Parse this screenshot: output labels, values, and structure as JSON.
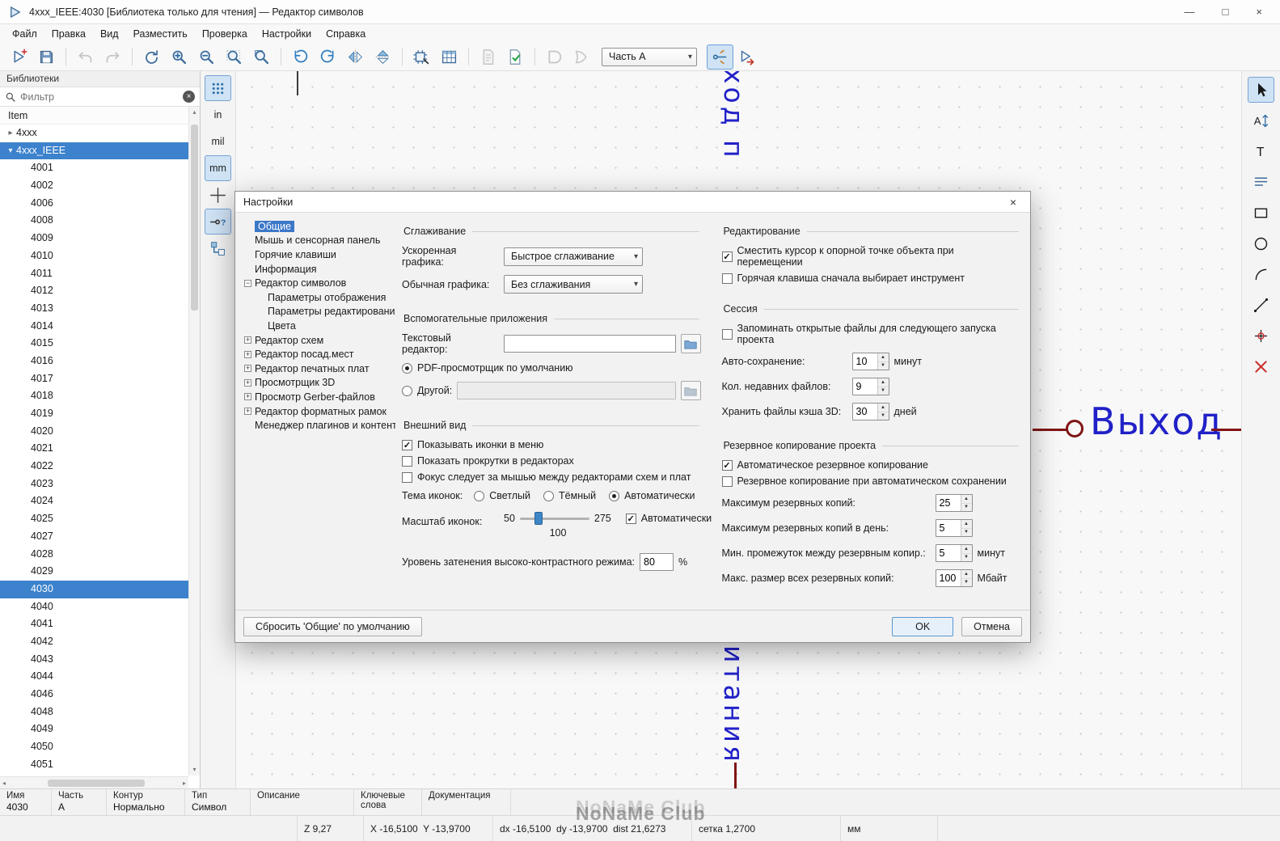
{
  "window": {
    "title": "4xxx_IEEE:4030 [Библиотека только для чтения] — Редактор символов",
    "minimize": "—",
    "maximize": "□",
    "close": "×"
  },
  "menubar": {
    "items": [
      "Файл",
      "Правка",
      "Вид",
      "Разместить",
      "Проверка",
      "Настройки",
      "Справка"
    ]
  },
  "toolbar": {
    "part_selector": "Часть A",
    "items": [
      {
        "id": "new-symbol"
      },
      {
        "id": "save"
      },
      {
        "sep": true
      },
      {
        "id": "undo",
        "disabled": true
      },
      {
        "id": "redo",
        "disabled": true
      },
      {
        "sep": true
      },
      {
        "id": "refresh-view"
      },
      {
        "id": "zoom-in"
      },
      {
        "id": "zoom-out"
      },
      {
        "id": "zoom-fit"
      },
      {
        "id": "zoom-selection"
      },
      {
        "sep": true
      },
      {
        "id": "rotate-left"
      },
      {
        "id": "rotate-right"
      },
      {
        "id": "mirror-h"
      },
      {
        "id": "mirror-v"
      },
      {
        "sep": true
      },
      {
        "id": "symbol-properties"
      },
      {
        "id": "pin-table"
      },
      {
        "sep": true
      },
      {
        "id": "datasheet",
        "disabled": true
      },
      {
        "id": "erc-check"
      },
      {
        "sep": true
      },
      {
        "id": "demorgan-standard",
        "disabled": true
      },
      {
        "id": "demorgan-alternate",
        "disabled": true
      },
      {
        "select": true
      },
      {
        "id": "sync-pins",
        "active": true
      },
      {
        "id": "add-to-schematic"
      }
    ]
  },
  "left_toolbar": {
    "items": [
      {
        "id": "grid-visibility",
        "active": true
      },
      {
        "id": "unit-inches",
        "label": "in"
      },
      {
        "id": "unit-mils",
        "label": "mil"
      },
      {
        "id": "unit-mm",
        "label": "mm",
        "active": true
      },
      {
        "id": "cursor-shape"
      },
      {
        "id": "pin-type",
        "active": true
      },
      {
        "id": "symbol-tree"
      }
    ]
  },
  "right_toolbar": {
    "items": [
      {
        "id": "select-tool",
        "active": true
      },
      {
        "id": "text-size-tool"
      },
      {
        "id": "text-tool"
      },
      {
        "id": "fields-table"
      },
      {
        "id": "rectangle-tool"
      },
      {
        "id": "circle-tool"
      },
      {
        "id": "arc-tool"
      },
      {
        "id": "line-tool"
      },
      {
        "id": "anchor-tool"
      },
      {
        "id": "delete-tool"
      }
    ]
  },
  "libraries": {
    "header": "Библиотеки",
    "filter_placeholder": "Фильтр",
    "root": "Item",
    "group": "4xxx",
    "library": "4xxx_IEEE",
    "selected": "4030",
    "items": [
      "4001",
      "4002",
      "4006",
      "4008",
      "4009",
      "4010",
      "4011",
      "4012",
      "4013",
      "4014",
      "4015",
      "4016",
      "4017",
      "4018",
      "4019",
      "4020",
      "4021",
      "4022",
      "4023",
      "4024",
      "4025",
      "4027",
      "4028",
      "4029",
      "4030",
      "4040",
      "4041",
      "4042",
      "4043",
      "4044",
      "4046",
      "4048",
      "4049",
      "4050",
      "4051"
    ]
  },
  "canvas": {
    "pin_label_vertical_top": "ход п",
    "pin_label_vertical_bottom": "итания",
    "pin_label_horizontal": "Выход",
    "label_color": "#2121c8",
    "pin_color": "#801515"
  },
  "dialog": {
    "title": "Настройки",
    "close": "×",
    "tree": [
      {
        "label": "Общие",
        "level": 0,
        "selected": true
      },
      {
        "label": "Мышь и сенсорная панель",
        "level": 0
      },
      {
        "label": "Горячие клавиши",
        "level": 0
      },
      {
        "label": "Информация",
        "level": 0
      },
      {
        "label": "Редактор символов",
        "level": 0,
        "expander": "minus"
      },
      {
        "label": "Параметры отображения",
        "level": 1
      },
      {
        "label": "Параметры редактирования",
        "level": 1
      },
      {
        "label": "Цвета",
        "level": 1
      },
      {
        "label": "Редактор схем",
        "level": 0,
        "expander": "plus"
      },
      {
        "label": "Редактор посад.мест",
        "level": 0,
        "expander": "plus"
      },
      {
        "label": "Редактор печатных плат",
        "level": 0,
        "expander": "plus"
      },
      {
        "label": "Просмотрщик 3D",
        "level": 0,
        "expander": "plus"
      },
      {
        "label": "Просмотр Gerber-файлов",
        "level": 0,
        "expander": "plus"
      },
      {
        "label": "Редактор форматных рамок",
        "level": 0,
        "expander": "plus"
      },
      {
        "label": "Менеджер плагинов и контента",
        "level": 0
      }
    ],
    "antialiasing": {
      "heading": "Сглаживание",
      "accel_label": "Ускоренная графика:",
      "accel_value": "Быстрое сглаживание",
      "fallback_label": "Обычная графика:",
      "fallback_value": "Без сглаживания"
    },
    "helper_apps": {
      "heading": "Вспомогательные приложения",
      "text_editor_label": "Текстовый редактор:",
      "text_editor_value": "",
      "pdf_default": {
        "label": "PDF-просмотрщик по умолчанию",
        "checked": true
      },
      "pdf_other": {
        "label": "Другой:",
        "checked": false
      },
      "pdf_other_value": ""
    },
    "appearance": {
      "heading": "Внешний вид",
      "cb_icons_in_menus": {
        "label": "Показывать иконки в меню",
        "checked": true
      },
      "cb_scrollbars": {
        "label": "Показать прокрутки в редакторах",
        "checked": false
      },
      "cb_focus_follow": {
        "label": "Фокус следует за мышью между редакторами схем и плат",
        "checked": false
      },
      "icon_theme_label": "Тема иконок:",
      "theme_light": {
        "label": "Светлый",
        "checked": false
      },
      "theme_dark": {
        "label": "Тёмный",
        "checked": false
      },
      "theme_auto": {
        "label": "Автоматически",
        "checked": true
      },
      "icon_scale_label": "Масштаб иконок:",
      "scale_min": "50",
      "scale_max": "275",
      "scale_value": "100",
      "cb_scale_auto": {
        "label": "Автоматически",
        "checked": true
      },
      "hc_dimming_label": "Уровень затенения высоко-контрастного режима:",
      "hc_dimming_value": "80",
      "hc_dimming_unit": "%"
    },
    "editing": {
      "heading": "Редактирование",
      "cb_warp": {
        "label": "Сместить курсор к опорной точке объекта при перемещении",
        "checked": true
      },
      "cb_hotkey_first": {
        "label": "Горячая клавиша сначала выбирает инструмент",
        "checked": false
      }
    },
    "session": {
      "heading": "Сессия",
      "cb_remember": {
        "label": "Запоминать открытые файлы для следующего запуска проекта",
        "checked": false
      },
      "autosave_label": "Авто-сохранение:",
      "autosave_value": "10",
      "autosave_unit": "минут",
      "recent_label": "Кол. недавних файлов:",
      "recent_value": "9",
      "cache3d_label": "Хранить файлы кэша 3D:",
      "cache3d_value": "30",
      "cache3d_unit": "дней"
    },
    "backup": {
      "heading": "Резервное копирование проекта",
      "cb_auto": {
        "label": "Автоматическое резервное копирование",
        "checked": true
      },
      "cb_on_autosave": {
        "label": "Резервное копирование при автоматическом сохранении",
        "checked": false
      },
      "max_label": "Максимум резервных копий:",
      "max_value": "25",
      "max_day_label": "Максимум резервных копий в день:",
      "max_day_value": "5",
      "min_interval_label": "Мин. промежуток между резервным копир.:",
      "min_interval_value": "5",
      "min_interval_unit": "минут",
      "max_size_label": "Макс. размер всех резервных копий:",
      "max_size_value": "100",
      "max_size_unit": "Мбайт"
    },
    "buttons": {
      "reset": "Сбросить 'Общие' по умолчанию",
      "ok": "OK",
      "cancel": "Отмена"
    }
  },
  "statusbar": {
    "fields": [
      {
        "label": "Имя",
        "value": "4030"
      },
      {
        "label": "Часть",
        "value": "A"
      },
      {
        "label": "Контур",
        "value": "Нормально"
      },
      {
        "label": "Тип",
        "value": "Символ"
      },
      {
        "label": "Описание",
        "value": ""
      },
      {
        "label": "Ключевые слова",
        "value": ""
      },
      {
        "label": "Документация",
        "value": ""
      }
    ],
    "zoom": "Z 9,27",
    "position": "X -16,5100  Y -13,9700",
    "delta": "dx -16,5100  dy -13,9700  dist 21,6273",
    "grid": "сетка 1,2700",
    "units": "мм"
  },
  "watermark": "NoNaMe Club"
}
